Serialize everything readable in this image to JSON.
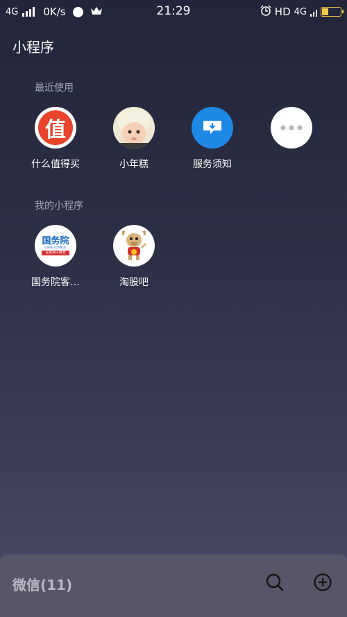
{
  "status_bar": {
    "network": "4G",
    "speed": "0K/s",
    "time": "21:29",
    "hd_label": "HD",
    "network_right": "4G"
  },
  "page_title": "小程序",
  "recent": {
    "section_label": "最近使用",
    "items": [
      {
        "label": "什么值得买",
        "icon": "zhi-logo-icon",
        "glyph": "值",
        "color": "#e8452c"
      },
      {
        "label": "小年糕",
        "icon": "baby-avatar-icon"
      },
      {
        "label": "服务须知",
        "icon": "service-notice-icon",
        "color": "#1e88e5"
      },
      {
        "label": "",
        "icon": "more-icon"
      }
    ]
  },
  "mine": {
    "section_label": "我的小程序",
    "items": [
      {
        "label": "国务院客…",
        "icon": "state-council-logo-icon",
        "logo_main": "国务院",
        "logo_sub": "STATE COUNCIL",
        "logo_tag": "互联网+督查"
      },
      {
        "label": "淘股吧",
        "icon": "bull-mascot-icon"
      }
    ]
  },
  "bottom_bar": {
    "title": "微信(11)",
    "search_icon": "search-icon",
    "add_icon": "add-circle-icon"
  }
}
